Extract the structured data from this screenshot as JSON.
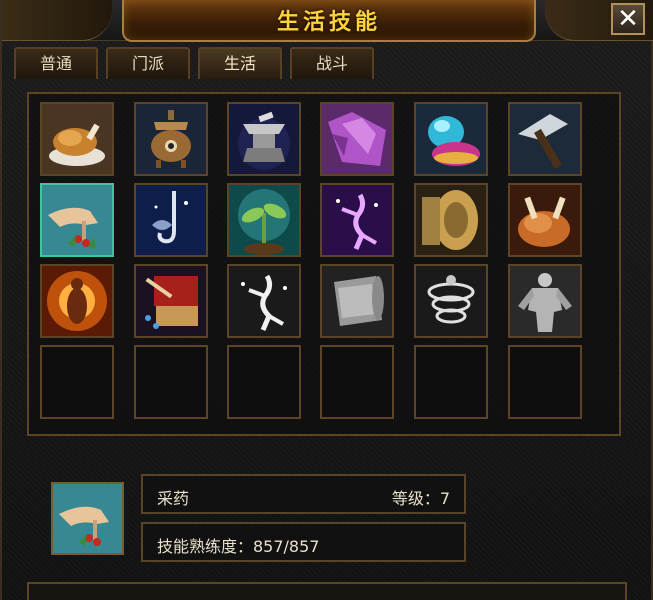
{
  "window": {
    "title": "生活技能",
    "close_label": "✕"
  },
  "tabs": [
    {
      "label": "普通"
    },
    {
      "label": "门派"
    },
    {
      "label": "生活"
    },
    {
      "label": "战斗"
    }
  ],
  "active_tab": "生活",
  "skills": [
    {
      "icon": "roast-chicken-icon"
    },
    {
      "icon": "pot-censer-icon"
    },
    {
      "icon": "anvil-icon"
    },
    {
      "icon": "robe-icon"
    },
    {
      "icon": "potion-flask-icon"
    },
    {
      "icon": "pickaxe-icon"
    },
    {
      "icon": "herb-picking-hand-icon",
      "selected": true
    },
    {
      "icon": "fishing-hook-icon"
    },
    {
      "icon": "sprout-icon"
    },
    {
      "icon": "purple-dancer-icon"
    },
    {
      "icon": "millstone-icon"
    },
    {
      "icon": "roast-turkey-icon"
    },
    {
      "icon": "fire-figure-icon"
    },
    {
      "icon": "book-brush-icon"
    },
    {
      "icon": "white-dancer-icon"
    },
    {
      "icon": "scroll-icon"
    },
    {
      "icon": "wind-swirl-icon"
    },
    {
      "icon": "muscle-statue-icon"
    },
    {
      "icon": "empty-slot"
    },
    {
      "icon": "empty-slot"
    },
    {
      "icon": "empty-slot"
    },
    {
      "icon": "empty-slot"
    },
    {
      "icon": "empty-slot"
    },
    {
      "icon": "empty-slot"
    }
  ],
  "selected_skill": {
    "icon": "herb-picking-hand-icon",
    "name": "采药",
    "level_label": "等级：7",
    "proficiency_label": "技能熟练度：857/857"
  },
  "colors": {
    "title": "#ffd33a",
    "border": "#5c4526",
    "selected_border": "#3fc4a0",
    "text": "#e8e0cc"
  }
}
